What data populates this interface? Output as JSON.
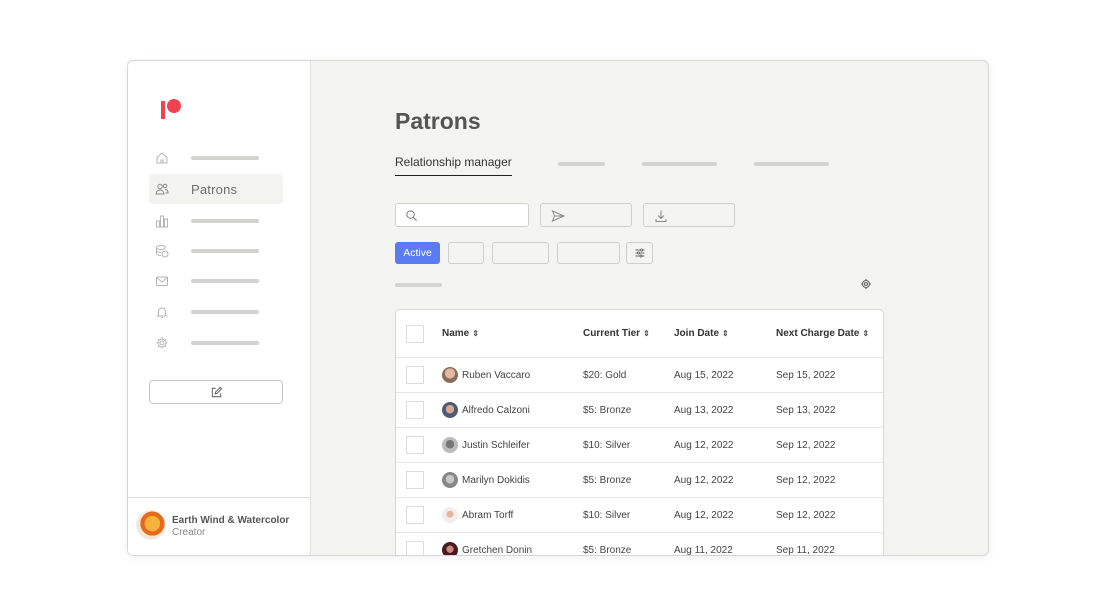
{
  "sidebar": {
    "logo": "patreon-logo",
    "items": [
      {
        "icon": "home-icon",
        "label": null
      },
      {
        "icon": "people-icon",
        "label": "Patrons",
        "active": true
      },
      {
        "icon": "bar-chart-icon",
        "label": null
      },
      {
        "icon": "coins-icon",
        "label": null
      },
      {
        "icon": "mail-icon",
        "label": null
      },
      {
        "icon": "bell-icon",
        "label": null
      },
      {
        "icon": "gear-icon",
        "label": null
      }
    ],
    "compose_icon": "edit-icon",
    "profile": {
      "name": "Earth Wind & Watercolor",
      "role": "Creator"
    }
  },
  "main": {
    "title": "Patrons",
    "tabs": [
      {
        "label": "Relationship manager",
        "active": true
      }
    ],
    "search": {
      "placeholder": "",
      "value": ""
    },
    "toolbar": {
      "send_icon": "send-icon",
      "download_icon": "download-icon"
    },
    "filters": {
      "active_label": "Active",
      "adjust_icon": "sliders-icon"
    },
    "accent_color": "#5a7cf2",
    "brand_color": "#f2414f"
  },
  "table": {
    "columns": [
      "Name",
      "Current Tier",
      "Join Date",
      "Next Charge Date"
    ],
    "sort_icon": "↕",
    "rows": [
      {
        "name": "Ruben Vaccaro",
        "tier": "$20: Gold",
        "join": "Aug 15, 2022",
        "next": "Sep 15, 2022"
      },
      {
        "name": "Alfredo Calzoni",
        "tier": "$5: Bronze",
        "join": "Aug 13, 2022",
        "next": "Sep 13, 2022"
      },
      {
        "name": "Justin Schleifer",
        "tier": "$10: Silver",
        "join": "Aug 12, 2022",
        "next": "Sep 12, 2022"
      },
      {
        "name": "Marilyn Dokidis",
        "tier": "$5: Bronze",
        "join": "Aug 12, 2022",
        "next": "Sep 12, 2022"
      },
      {
        "name": "Abram Torff",
        "tier": "$10: Silver",
        "join": "Aug 12, 2022",
        "next": "Sep 12, 2022"
      },
      {
        "name": "Gretchen Donin",
        "tier": "$5: Bronze",
        "join": "Aug 11, 2022",
        "next": "Sep 11, 2022"
      }
    ]
  }
}
